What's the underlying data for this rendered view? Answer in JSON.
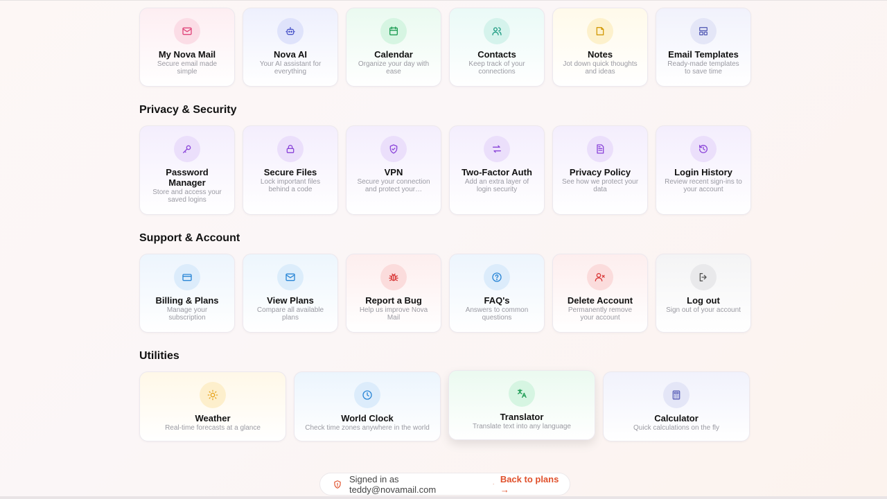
{
  "top_row": [
    {
      "title": "My Nova Mail",
      "desc": "Secure email made simple",
      "icon": "mail-icon",
      "bg": "#fdeef2",
      "circle": "#fbdde6",
      "color": "#e0457b"
    },
    {
      "title": "Nova AI",
      "desc": "Your AI assistant for everything",
      "icon": "robot-icon",
      "bg": "#eef0fd",
      "circle": "#dfe3fb",
      "color": "#4a55c9"
    },
    {
      "title": "Calendar",
      "desc": "Organize your day with ease",
      "icon": "calendar-icon",
      "bg": "#eafaf0",
      "circle": "#d6f5e2",
      "color": "#1f9d55"
    },
    {
      "title": "Contacts",
      "desc": "Keep track of your connections",
      "icon": "contacts-icon",
      "bg": "#eafaf7",
      "circle": "#d5f3ec",
      "color": "#1a9a80"
    },
    {
      "title": "Notes",
      "desc": "Jot down quick thoughts and ideas",
      "icon": "note-icon",
      "bg": "#fffaea",
      "circle": "#fdf1cc",
      "color": "#d39b0a"
    },
    {
      "title": "Email Templates",
      "desc": "Ready-made templates to save time",
      "icon": "template-icon",
      "bg": "#f1f2fc",
      "circle": "#e4e6f7",
      "color": "#5a61b8"
    }
  ],
  "privacy": {
    "title": "Privacy & Security",
    "cards": [
      {
        "title": "Password Manager",
        "desc": "Store and access your saved logins",
        "icon": "key-icon",
        "two_line": true
      },
      {
        "title": "Secure Files",
        "desc": "Lock important files behind a code",
        "icon": "lock-icon",
        "two_line": false
      },
      {
        "title": "VPN",
        "desc": "Secure your connection and protect your…",
        "icon": "shield-check-icon",
        "two_line": false
      },
      {
        "title": "Two-Factor Auth",
        "desc": "Add an extra layer of login security",
        "icon": "arrows-swap-icon",
        "two_line": false
      },
      {
        "title": "Privacy Policy",
        "desc": "See how we protect your data",
        "icon": "document-icon",
        "two_line": false
      },
      {
        "title": "Login History",
        "desc": "Review recent sign-ins to your account",
        "icon": "history-icon",
        "two_line": false
      }
    ],
    "accent": "#8b45d9",
    "bg": "#f4eefd",
    "circle": "#ebdffb"
  },
  "support": {
    "title": "Support & Account",
    "cards": [
      {
        "title": "Billing & Plans",
        "desc": "Manage your subscription",
        "icon": "credit-card-icon",
        "bg": "#edf5fd",
        "circle": "#dcecfb",
        "color": "#2a86d6"
      },
      {
        "title": "View Plans",
        "desc": "Compare all available plans",
        "icon": "mail-icon",
        "bg": "#edf6fd",
        "circle": "#dcedfb",
        "color": "#2a86d6"
      },
      {
        "title": "Report a Bug",
        "desc": "Help us improve Nova Mail",
        "icon": "bug-icon",
        "bg": "#fdeeee",
        "circle": "#fbdcdc",
        "color": "#d93838"
      },
      {
        "title": "FAQ's",
        "desc": "Answers to common questions",
        "icon": "question-icon",
        "bg": "#edf5fd",
        "circle": "#dcecfb",
        "color": "#2a86d6"
      },
      {
        "title": "Delete Account",
        "desc": "Permanently remove your account",
        "icon": "user-x-icon",
        "bg": "#fdeeee",
        "circle": "#fbdcdc",
        "color": "#d93838"
      },
      {
        "title": "Log out",
        "desc": "Sign out of your account",
        "icon": "logout-icon",
        "bg": "#f4f4f5",
        "circle": "#e9e9eb",
        "color": "#555"
      }
    ]
  },
  "utilities": {
    "title": "Utilities",
    "cards": [
      {
        "title": "Weather",
        "desc": "Real-time forecasts at a glance",
        "icon": "sun-icon",
        "bg": "#fff8e8",
        "circle": "#fdefcc",
        "color": "#e5a21a"
      },
      {
        "title": "World Clock",
        "desc": "Check time zones anywhere in the world",
        "icon": "clock-icon",
        "bg": "#ecf5fd",
        "circle": "#dcecfb",
        "color": "#2a86d6"
      },
      {
        "title": "Translator",
        "desc": "Translate text into any language",
        "icon": "translate-icon",
        "bg": "#ebfaf0",
        "circle": "#d6f5e2",
        "color": "#1f9d55"
      },
      {
        "title": "Calculator",
        "desc": "Quick calculations on the fly",
        "icon": "calculator-icon",
        "bg": "#f1f2fc",
        "circle": "#e4e6f7",
        "color": "#5a61b8"
      }
    ]
  },
  "footer": {
    "signed_in": "Signed in as teddy@novamail.com",
    "separator": "·",
    "back": "Back to plans →",
    "icon": "shield-icon"
  }
}
